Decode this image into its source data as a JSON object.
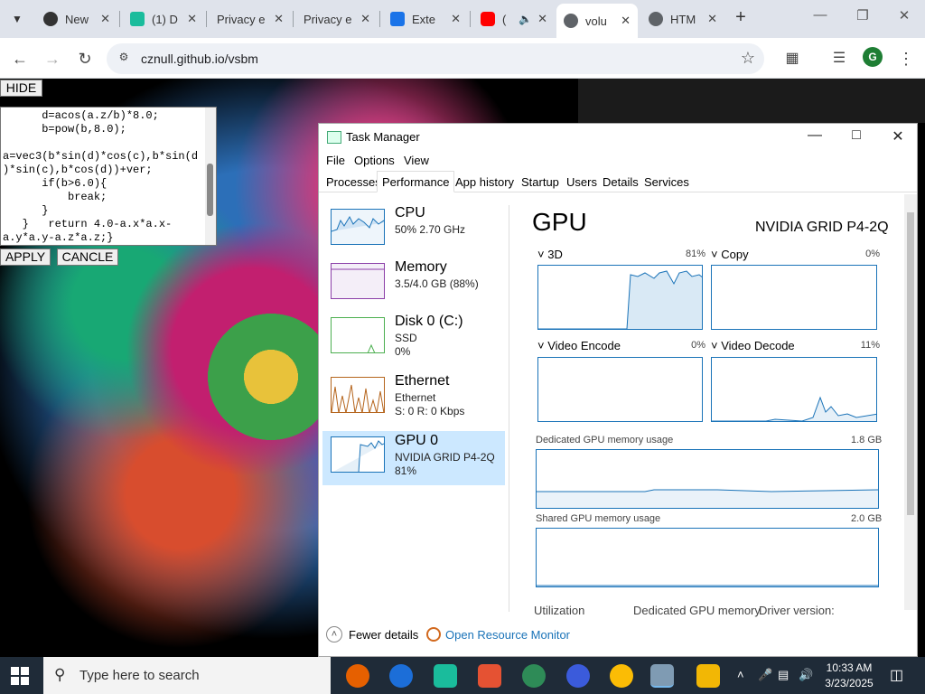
{
  "browser": {
    "tabs": [
      {
        "label": "New",
        "favicon": "github-icon",
        "color": "#333333"
      },
      {
        "label": "(1) D",
        "favicon": "discord-icon",
        "color": "#1abc9c"
      },
      {
        "label": "Privacy e",
        "favicon": "",
        "color": ""
      },
      {
        "label": "Privacy e",
        "favicon": "",
        "color": ""
      },
      {
        "label": "Exte",
        "favicon": "puzzle-icon",
        "color": "#1a73e8"
      },
      {
        "label": "(",
        "favicon": "youtube-icon",
        "color": "#ff0000"
      },
      {
        "label": "volu",
        "favicon": "globe-icon",
        "color": "#5f6368"
      },
      {
        "label": "HTM",
        "favicon": "globe-icon",
        "color": "#5f6368"
      }
    ],
    "url": "cznull.github.io/vsbm",
    "profile_initial": "G"
  },
  "overlay": {
    "hide_label": "HIDE",
    "apply_label": "APPLY",
    "cancel_label": "CANCLE",
    "code": "      d=acos(a.z/b)*8.0;\n      b=pow(b,8.0);\n\na=vec3(b*sin(d)*cos(c),b*sin(d\n)*sin(c),b*cos(d))+ver;\n      if(b>6.0){\n          break;\n      }\n   }   return 4.0-a.x*a.x-\na.y*a.y-a.z*a.z;}"
  },
  "task_manager": {
    "title": "Task Manager",
    "menu": [
      "File",
      "Options",
      "View"
    ],
    "tabs": [
      "Processes",
      "Performance",
      "App history",
      "Startup",
      "Users",
      "Details",
      "Services"
    ],
    "active_tab": "Performance",
    "sidebar": [
      {
        "name": "CPU",
        "line1": "50% 2.70 GHz",
        "line2": "",
        "color": "#1a73b8"
      },
      {
        "name": "Memory",
        "line1": "3.5/4.0 GB (88%)",
        "line2": "",
        "color": "#8b3fa8"
      },
      {
        "name": "Disk 0 (C:)",
        "line1": "SSD",
        "line2": "0%",
        "color": "#4caf50"
      },
      {
        "name": "Ethernet",
        "line1": "Ethernet",
        "line2": "S: 0 R: 0 Kbps",
        "color": "#b5651d"
      },
      {
        "name": "GPU 0",
        "line1": "NVIDIA GRID P4-2Q",
        "line2": "81%",
        "color": "#1a73b8"
      }
    ],
    "gpu": {
      "title": "GPU",
      "model": "NVIDIA GRID P4-2Q",
      "engines": [
        {
          "label": "3D",
          "percent": "81%",
          "utilization": 0.81
        },
        {
          "label": "Copy",
          "percent": "0%",
          "utilization": 0.0
        },
        {
          "label": "Video Encode",
          "percent": "0%",
          "utilization": 0.0
        },
        {
          "label": "Video Decode",
          "percent": "11%",
          "utilization": 0.11
        }
      ],
      "dedicated_label": "Dedicated GPU memory usage",
      "dedicated_max": "1.8 GB",
      "shared_label": "Shared GPU memory usage",
      "shared_max": "2.0 GB",
      "bottom_labels": [
        "Utilization",
        "Dedicated GPU memory",
        "Driver version:"
      ]
    },
    "footer": {
      "fewer_details": "Fewer details",
      "open_resource_monitor": "Open Resource Monitor"
    }
  },
  "taskbar": {
    "search_placeholder": "Type here to search",
    "time": "10:33 AM",
    "date": "3/23/2025"
  }
}
